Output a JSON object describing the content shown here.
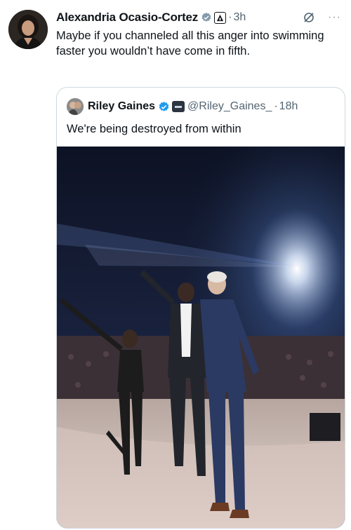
{
  "tweet": {
    "author_name": "Alexandria Ocasio-Cortez",
    "time_separator": "·",
    "time": "3h",
    "more_label": "···",
    "text": "Maybe if you channeled all this anger into swimming faster you wouldn’t have come in fifth."
  },
  "quoted_tweet": {
    "author_name": "Riley Gaines",
    "handle": "@Riley_Gaines_",
    "time_separator": "·",
    "time": "18h",
    "text": "We're being destroyed from within"
  },
  "colors": {
    "verified_blue": "#1d9bf0",
    "secondary_text": "#536471",
    "border": "#cfd9de"
  },
  "icons": {
    "verified": "verified-badge-icon",
    "affiliation": "affiliation-badge-icon",
    "grok": "grok-icon",
    "more": "more-icon"
  }
}
